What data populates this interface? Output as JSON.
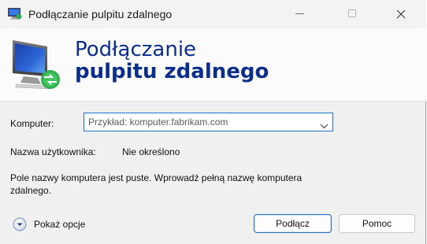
{
  "window": {
    "title": "Podłączanie pulpitu zdalnego"
  },
  "banner": {
    "line1": "Podłączanie",
    "line2": "pulpitu zdalnego"
  },
  "form": {
    "computer_label": "Komputer:",
    "computer_placeholder": "Przykład: komputer.fabrikam.com",
    "user_label": "Nazwa użytkownika:",
    "user_value": "Nie określono",
    "message": "Pole nazwy komputera jest puste. Wprowadź pełną nazwę komputera zdalnego."
  },
  "footer": {
    "options_label": "Pokaż opcje",
    "connect_label": "Podłącz",
    "help_label": "Pomoc"
  },
  "colors": {
    "banner_text": "#0b2d8c",
    "accent": "#1a73c8"
  },
  "icons": {
    "app": "remote-desktop-icon",
    "banner": "remote-desktop-monitor-icon",
    "options": "chevron-down-circle-icon",
    "dropdown": "chevron-down-icon"
  }
}
